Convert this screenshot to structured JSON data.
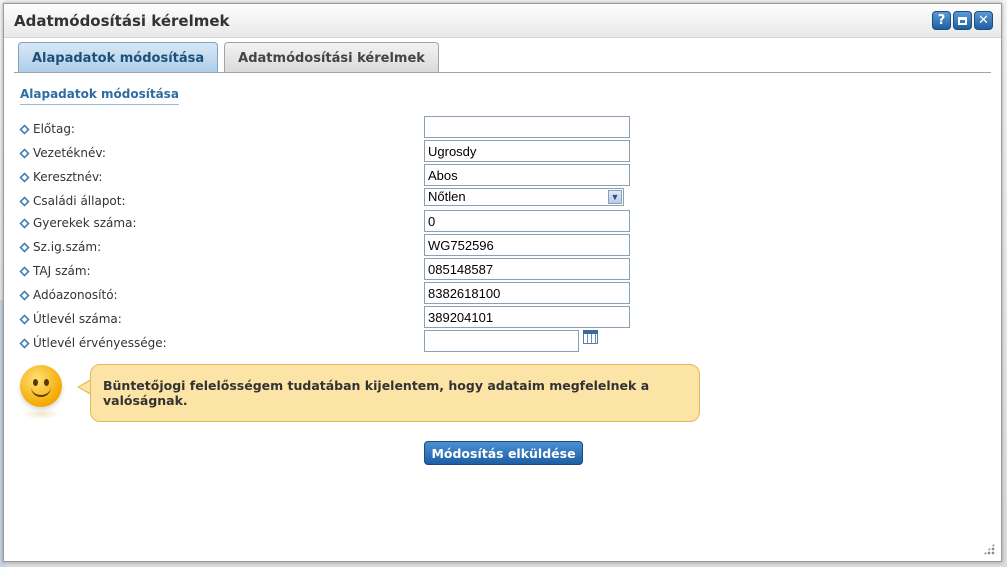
{
  "dialog": {
    "title": "Adatmódosítási kérelmek",
    "buttons": {
      "help": "?",
      "close": "✕"
    }
  },
  "tabs": [
    {
      "label": "Alapadatok módosítása",
      "active": true
    },
    {
      "label": "Adatmódosítási kérelmek",
      "active": false
    }
  ],
  "section_title": "Alapadatok módosítása",
  "form": {
    "prefix": {
      "label": "Előtag:",
      "value": ""
    },
    "last_name": {
      "label": "Vezetéknév:",
      "value": "Ugrosdy"
    },
    "first_name": {
      "label": "Keresztnév:",
      "value": "Abos"
    },
    "marital_status": {
      "label": "Családi állapot:",
      "value": "Nőtlen"
    },
    "children": {
      "label": "Gyerekek száma:",
      "value": "0"
    },
    "id_number": {
      "label": "Sz.ig.szám:",
      "value": "WG752596"
    },
    "taj_number": {
      "label": "TAJ szám:",
      "value": "085148587"
    },
    "tax_id": {
      "label": "Adóazonosító:",
      "value": "8382618100"
    },
    "passport_number": {
      "label": "Útlevél száma:",
      "value": "389204101"
    },
    "passport_validity": {
      "label": "Útlevél érvényessége:",
      "value": ""
    }
  },
  "notice": "Büntetőjogi felelősségem tudatában kijelentem, hogy adataim megfelelnek a valóságnak.",
  "submit_label": "Módosítás elküldése"
}
